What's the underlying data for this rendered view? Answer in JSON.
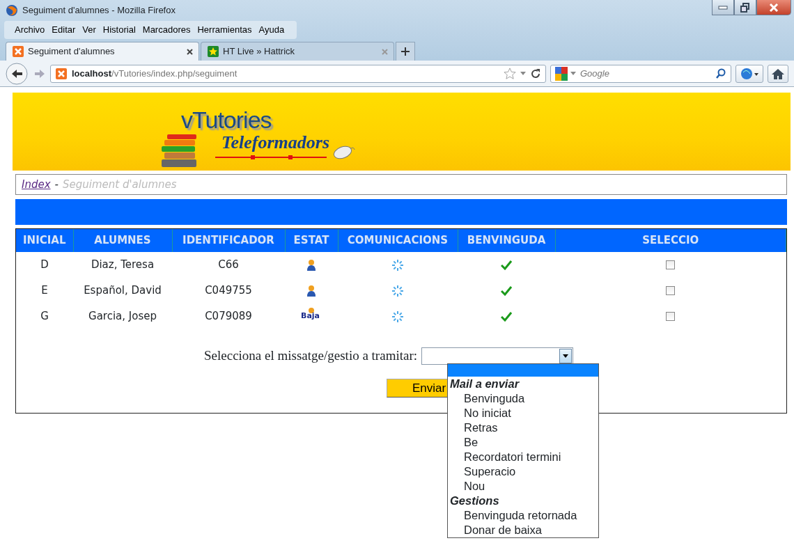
{
  "window": {
    "title": "Seguiment d'alumnes - Mozilla Firefox"
  },
  "menu": [
    "Archivo",
    "Editar",
    "Ver",
    "Historial",
    "Marcadores",
    "Herramientas",
    "Ayuda"
  ],
  "tabs": [
    {
      "label": "Seguiment d'alumnes",
      "selected": true
    },
    {
      "label": "HT Live » Hattrick",
      "selected": false
    }
  ],
  "address": {
    "host": "localhost",
    "path": "/vTutories/index.php/seguiment"
  },
  "search": {
    "placeholder": "Google"
  },
  "banner": {
    "title": "vTutories",
    "subtitle": "Teleformadors"
  },
  "breadcrumb": {
    "link": "Index",
    "separator": "-",
    "current": "Seguiment d'alumnes"
  },
  "table": {
    "columns": [
      "INICIAL",
      "ALUMNES",
      "IDENTIFICADOR",
      "ESTAT",
      "COMUNICACIONS",
      "BENVINGUDA",
      "SELECCIO"
    ],
    "rows": [
      {
        "initial": "D",
        "name": "Diaz, Teresa",
        "id": "C66",
        "status": {
          "kind": "active"
        },
        "welcome": true,
        "checked": false
      },
      {
        "initial": "E",
        "name": "Español, David",
        "id": "C049755",
        "status": {
          "kind": "active"
        },
        "welcome": true,
        "checked": false
      },
      {
        "initial": "G",
        "name": "Garcia, Josep",
        "id": "C079089",
        "status": {
          "kind": "baja",
          "label": "Baja"
        },
        "welcome": true,
        "checked": false
      }
    ]
  },
  "form": {
    "label": "Selecciona el missatge/gestio a tramitar:",
    "button": "Enviar",
    "dropdown": {
      "expanded": true,
      "blank_selected": true,
      "groups": [
        {
          "label": "Mail a enviar",
          "options": [
            {
              "label": "Benvinguda",
              "selected": false
            },
            {
              "label": "No iniciat",
              "selected": false
            },
            {
              "label": "Retras",
              "selected": false
            },
            {
              "label": "Be",
              "selected": false
            },
            {
              "label": "Recordatori termini",
              "selected": false
            },
            {
              "label": "Superacio",
              "selected": false
            },
            {
              "label": "Nou",
              "selected": false
            }
          ]
        },
        {
          "label": "Gestions",
          "options": [
            {
              "label": "Benvinguda retornada",
              "selected": false
            },
            {
              "label": "Donar de baixa",
              "selected": false
            }
          ]
        }
      ]
    }
  }
}
